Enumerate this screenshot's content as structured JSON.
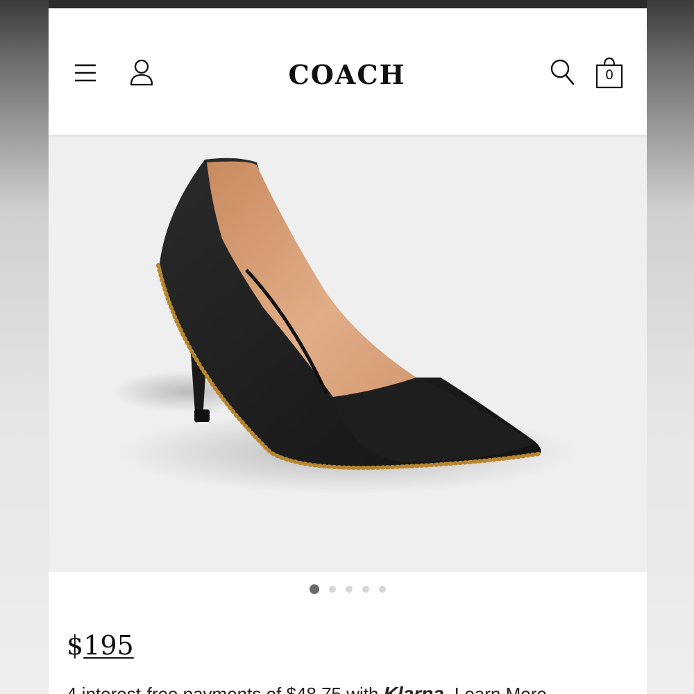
{
  "brand": {
    "logo_text": "COACH"
  },
  "header": {
    "icons": [
      "menu-icon",
      "account-icon",
      "search-icon",
      "shopping-bag-icon"
    ],
    "bag_count": "0"
  },
  "gallery": {
    "image": "black-leather-pump-with-gold-beadchain-trim",
    "slide_count": 5,
    "active_slide": 1
  },
  "product": {
    "price_currency": "$",
    "price_amount": "195",
    "installment_prefix": "4 interest-free payments of $48.75 with",
    "installment_provider": "Klarna.",
    "installment_link": "Learn More"
  },
  "colors": {
    "header_bg": "#ffffff",
    "hero_bg": "#efefef",
    "shoe_black": "#1b1b1b",
    "lining_tan": "#d9a37c",
    "bead_gold": "#b8862e",
    "dot_active": "#6b6b6b",
    "dot_inactive": "#d6d6d6"
  }
}
